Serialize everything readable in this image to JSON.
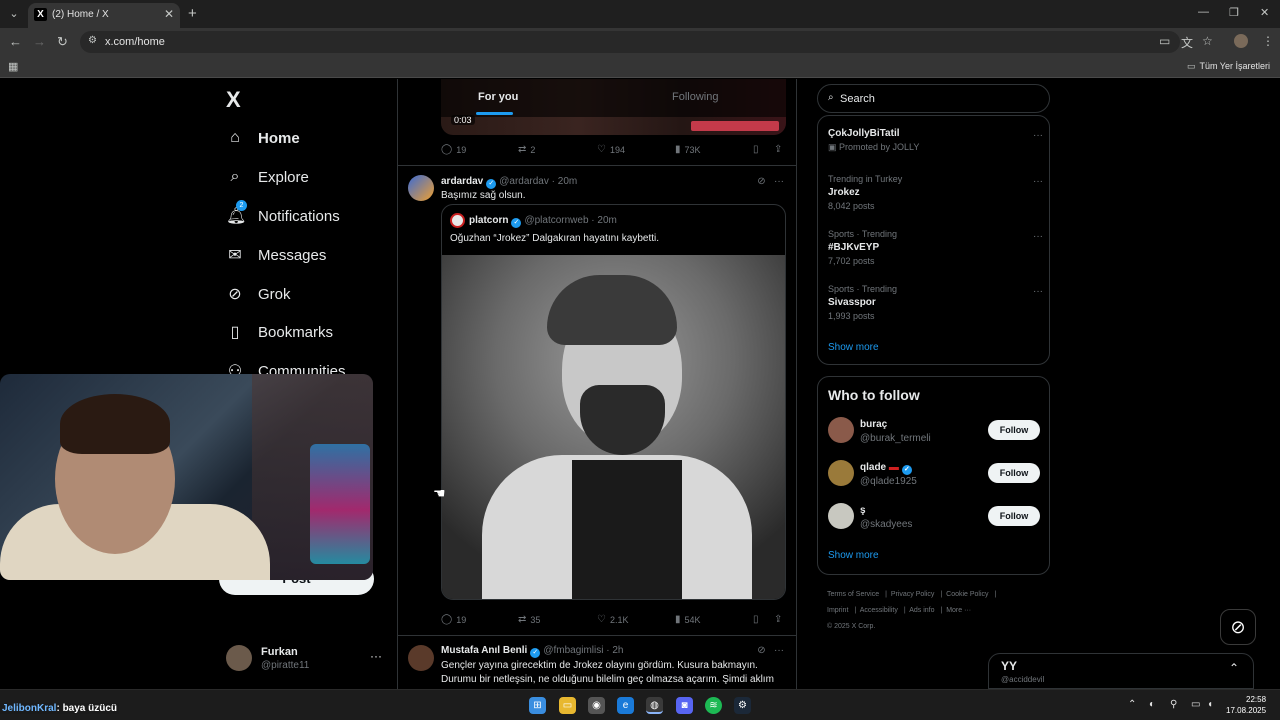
{
  "browser": {
    "tab_title": "(2) Home / X",
    "favicon_letter": "X",
    "url": "x.com/home",
    "bookmarks_folder": "Tüm Yer İşaretleri"
  },
  "sidebar": {
    "logo": "X",
    "items": [
      {
        "label": "Home",
        "icon": "home-icon"
      },
      {
        "label": "Explore",
        "icon": "search-icon"
      },
      {
        "label": "Notifications",
        "icon": "bell-icon",
        "badge": "2"
      },
      {
        "label": "Messages",
        "icon": "mail-icon"
      },
      {
        "label": "Grok",
        "icon": "grok-icon"
      },
      {
        "label": "Bookmarks",
        "icon": "bookmark-icon"
      },
      {
        "label": "Communities",
        "icon": "communities-icon"
      }
    ],
    "post_label": "Post",
    "account": {
      "name": "Furkan",
      "handle": "@piratte11"
    }
  },
  "feed": {
    "tabs": [
      "For you",
      "Following"
    ],
    "prev_post": {
      "video_time": "0:03",
      "replies": "19",
      "reposts": "2",
      "likes": "194",
      "views": "73K"
    },
    "post1": {
      "name": "ardardav",
      "handle": "@ardardav",
      "time": "20m",
      "text": "Başımız sağ olsun.",
      "quote": {
        "name": "platcorn",
        "handle": "@platcornweb",
        "time": "20m",
        "text": "Oğuzhan “Jrokez” Dalgakıran hayatını kaybetti."
      },
      "replies": "19",
      "reposts": "35",
      "likes": "2.1K",
      "views": "54K"
    },
    "post2": {
      "name": "Mustafa Anıl Benli",
      "handle": "@fmbagimlisi",
      "time": "2h",
      "text": "Gençler yayına girecektim de Jrokez olayını gördüm. Kusura bakmayın. Durumu bir netleşsin, ne olduğunu bilelim geç olmazsa açarım. Şimdi aklım"
    }
  },
  "right": {
    "search_placeholder": "Search",
    "trends": [
      {
        "category": "",
        "name": "ÇokJollyBiTatil",
        "count": "Promoted by JOLLY"
      },
      {
        "category": "Trending in Turkey",
        "name": "Jrokez",
        "count": "8,042 posts"
      },
      {
        "category": "Sports · Trending",
        "name": "#BJKvEYP",
        "count": "7,702 posts"
      },
      {
        "category": "Sports · Trending",
        "name": "Sivasspor",
        "count": "1,993 posts"
      }
    ],
    "show_more": "Show more",
    "who_to_follow": {
      "title": "Who to follow",
      "users": [
        {
          "name": "buraç",
          "handle": "@burak_termeli"
        },
        {
          "name": "qlade",
          "handle": "@qlade1925"
        },
        {
          "name": "ş",
          "handle": "@skadyees"
        }
      ],
      "follow_label": "Follow",
      "show_more": "Show more"
    },
    "footer": [
      "Terms of Service",
      "Privacy Policy",
      "Cookie Policy",
      "Imprint",
      "Accessibility",
      "Ads info",
      "More ···",
      "© 2025 X Corp."
    ]
  },
  "messages_drawer": {
    "title": "YY",
    "sub": "@acciddevil"
  },
  "chat": {
    "user": "JelibonKral",
    "message": ": baya üzücü"
  },
  "clock": {
    "time": "22:58",
    "date": "17.08.2025"
  },
  "colors": {
    "accent": "#1d9bf0",
    "background": "#000000",
    "border": "#2f3336",
    "secondary_text": "#71767b"
  }
}
